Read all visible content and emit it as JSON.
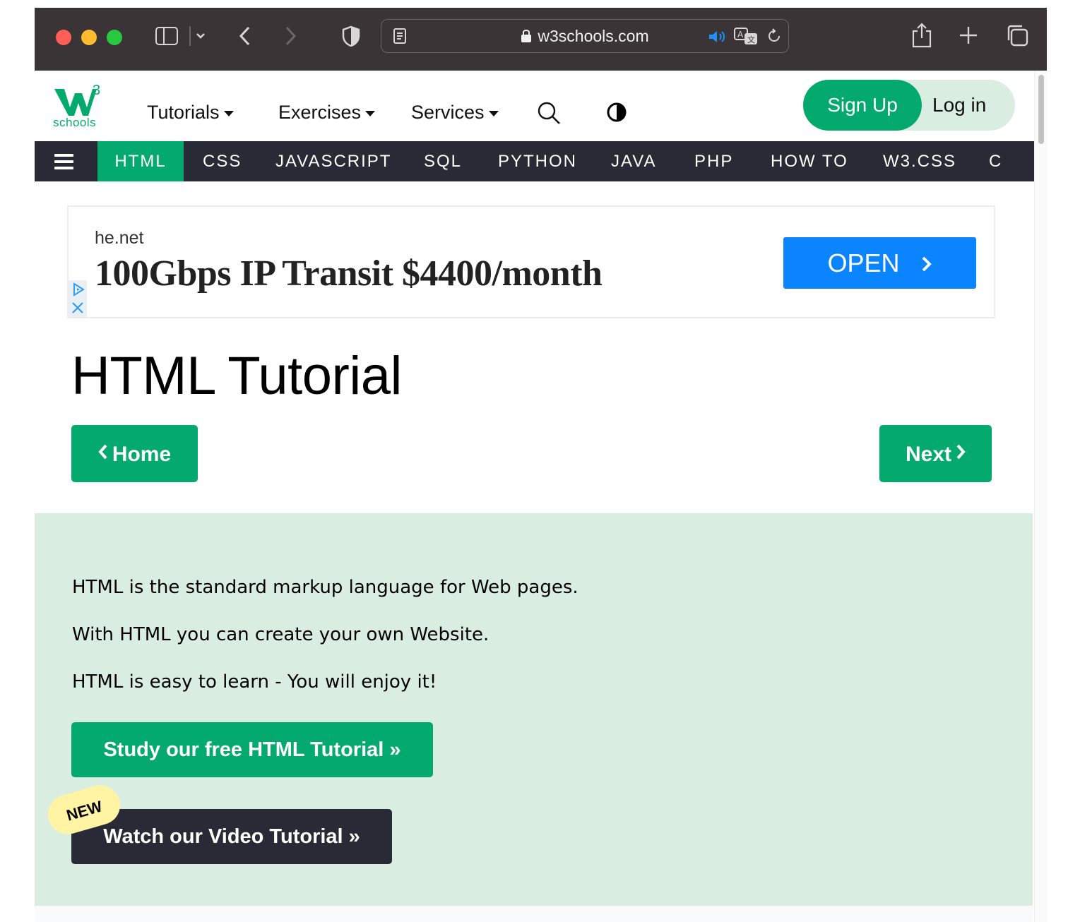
{
  "browser": {
    "url": "w3schools.com"
  },
  "logo": {
    "superscript": "3",
    "wordmark": "schools",
    "brand_color": "#04aa6d"
  },
  "nav": {
    "tutorials": "Tutorials",
    "exercises": "Exercises",
    "services": "Services",
    "signup": "Sign Up",
    "login": "Log in"
  },
  "topics": [
    "HTML",
    "CSS",
    "JAVASCRIPT",
    "SQL",
    "PYTHON",
    "JAVA",
    "PHP",
    "HOW TO",
    "W3.CSS",
    "C"
  ],
  "ad": {
    "domain": "he.net",
    "headline": "100Gbps IP Transit $4400/month",
    "cta": "OPEN"
  },
  "main": {
    "title": "HTML Tutorial",
    "home_label": "Home",
    "next_label": "Next",
    "intro": [
      "HTML is the standard markup language for Web pages.",
      "With HTML you can create your own Website.",
      "HTML is easy to learn - You will enjoy it!"
    ],
    "study_button": "Study our free HTML Tutorial »",
    "new_badge": "NEW",
    "video_button": "Watch our Video Tutorial »"
  },
  "colors": {
    "toolbar": "#3b3436",
    "topic_bar": "#282a35",
    "intro_bg": "#d9eee1",
    "ad_button": "#0a84ff",
    "badge": "#fff4a3"
  }
}
